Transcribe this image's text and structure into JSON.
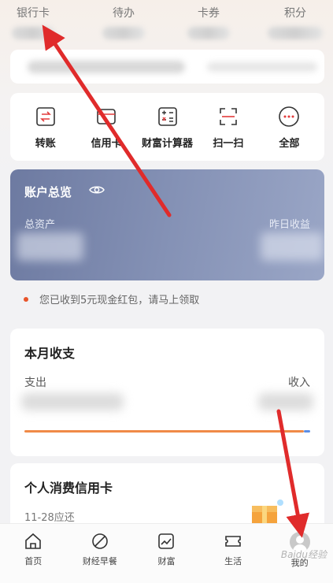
{
  "top_stats": [
    {
      "label": "银行卡"
    },
    {
      "label": "待办"
    },
    {
      "label": "卡券"
    },
    {
      "label": "积分"
    }
  ],
  "quick_actions": [
    {
      "label": "转账",
      "icon": "transfer-icon"
    },
    {
      "label": "信用卡",
      "icon": "credit-card-icon"
    },
    {
      "label": "财富计算器",
      "icon": "calculator-icon"
    },
    {
      "label": "扫一扫",
      "icon": "scan-icon"
    },
    {
      "label": "全部",
      "icon": "more-icon"
    }
  ],
  "account_overview": {
    "title": "账户总览",
    "total_assets_label": "总资产",
    "yesterday_income_label": "昨日收益"
  },
  "red_packet_notice": "您已收到5元现金红包，请马上领取",
  "monthly": {
    "title": "本月收支",
    "expense_label": "支出",
    "income_label": "收入"
  },
  "credit_card": {
    "title": "个人消费信用卡",
    "due": "11-28应还"
  },
  "tabs": [
    {
      "label": "首页",
      "icon": "home-icon"
    },
    {
      "label": "财经早餐",
      "icon": "leaf-icon"
    },
    {
      "label": "财富",
      "icon": "chart-icon"
    },
    {
      "label": "生活",
      "icon": "ticket-icon"
    },
    {
      "label": "我的",
      "icon": "avatar"
    }
  ],
  "watermark": "Baidu经验",
  "colors": {
    "overview_gradient_start": "#6d7aa1",
    "overview_gradient_end": "#9aa6c6",
    "arrow": "#e02b2b",
    "expense_bar": "#f08a47",
    "income_bar": "#5b8ee6",
    "notice_dot": "#e8542a"
  }
}
